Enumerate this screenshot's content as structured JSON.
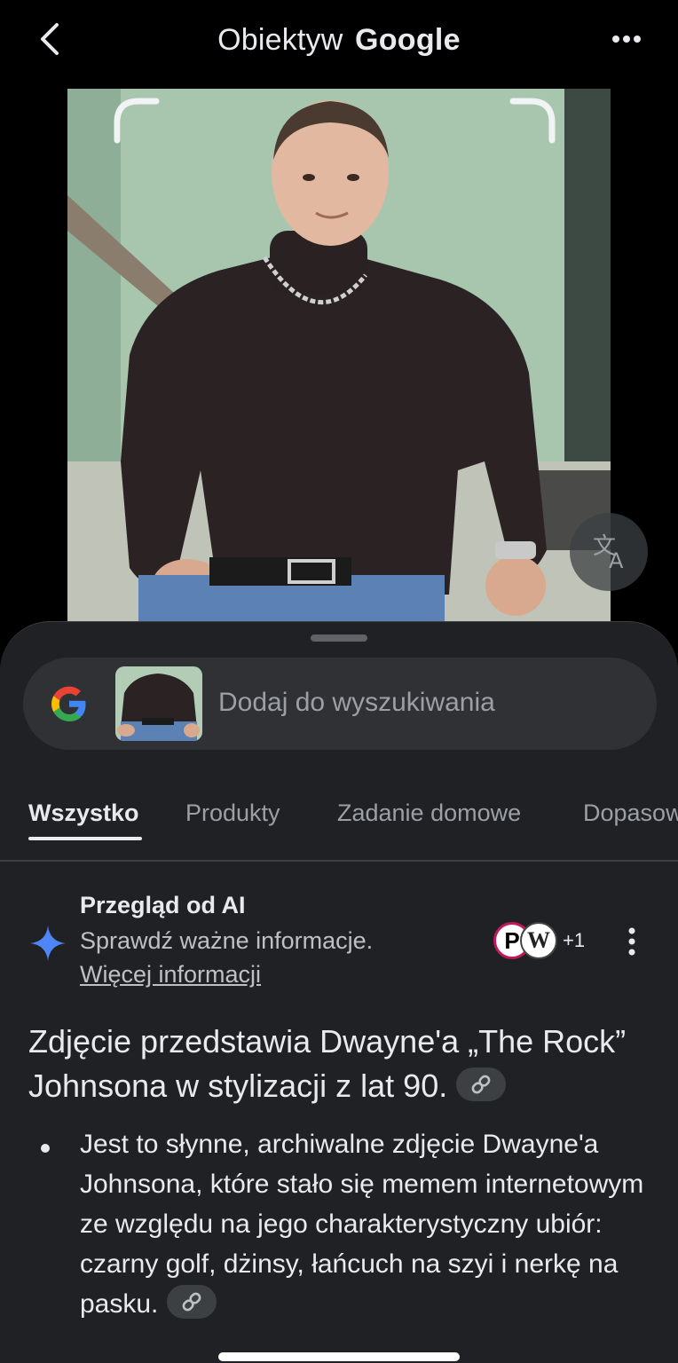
{
  "header": {
    "title_part1": "Obiektyw",
    "title_part2": "Google",
    "back_icon": "chevron-left-icon",
    "more_icon": "more-horiz-icon"
  },
  "photo": {
    "translate_icon": "translate-icon"
  },
  "search": {
    "placeholder": "Dodaj do wyszukiwania",
    "logo_icon": "google-g-icon"
  },
  "tabs": [
    {
      "label": "Wszystko",
      "active": true
    },
    {
      "label": "Produkty",
      "active": false
    },
    {
      "label": "Zadanie domowe",
      "active": false
    },
    {
      "label": "Dopasow",
      "active": false
    }
  ],
  "ai_overview": {
    "title": "Przegląd od AI",
    "subtitle": "Sprawdź ważne informacje.",
    "more_link": "Więcej informacji",
    "source_p": "P",
    "source_w": "W",
    "extra_sources": "+1",
    "sparkle_color": "#4e86f6"
  },
  "answer": {
    "headline": "Zdjęcie przedstawia Dwayne'a „The Rock” Johnsona w stylizacji z lat 90.",
    "bullet": "Jest to słynne, archiwalne zdjęcie Dwayne'a Johnsona, które stało się memem internetowym ze względu na jego charakterystyczny ubiór: czarny golf, dżinsy, łańcuch na szyi i nerkę na pasku."
  },
  "colors": {
    "background": "#000000",
    "sheet": "#202124",
    "search_bg": "#303134",
    "text_primary": "#e8eaed",
    "text_secondary": "#9aa0a6"
  }
}
